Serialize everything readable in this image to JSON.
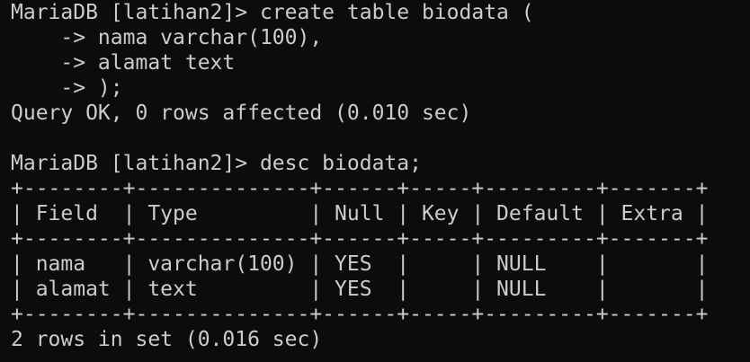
{
  "terminal": {
    "lines": [
      "MariaDB [latihan2]> create table biodata (",
      "    -> nama varchar(100),",
      "    -> alamat text",
      "    -> );",
      "Query OK, 0 rows affected (0.010 sec)",
      "",
      "MariaDB [latihan2]> desc biodata;",
      "+--------+--------------+------+-----+---------+-------+",
      "| Field  | Type         | Null | Key | Default | Extra |",
      "+--------+--------------+------+-----+---------+-------+",
      "| nama   | varchar(100) | YES  |     | NULL    |       |",
      "| alamat | text         | YES  |     | NULL    |       |",
      "+--------+--------------+------+-----+---------+-------+",
      "2 rows in set (0.016 sec)"
    ]
  }
}
